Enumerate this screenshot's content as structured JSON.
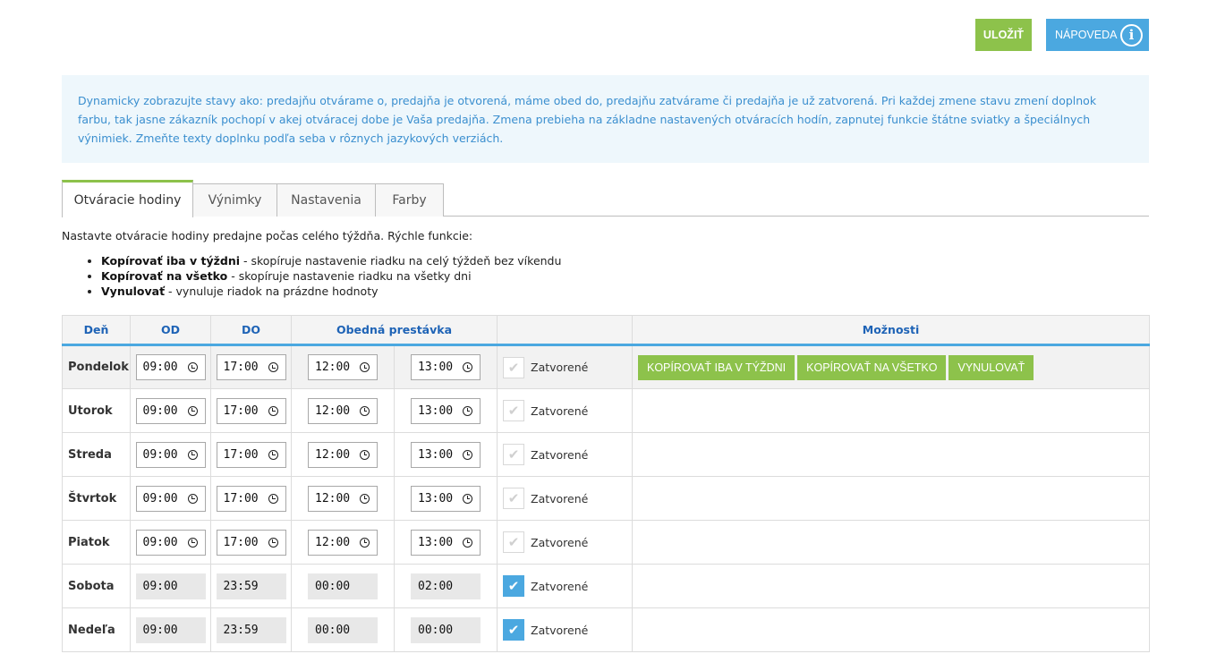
{
  "header": {
    "save_label": "ULOŽIŤ",
    "help_label": "NÁPOVEDA",
    "help_icon": "info-icon"
  },
  "notice": {
    "text": "Dynamicky zobrazujte stavy ako: predajňu otvárame o, predajňa je otvorená, máme obed do, predajňu zatvárame či predajňa je už zatvorená. Pri každej zmene stavu zmení doplnok farbu, tak jasne zákazník pochopí v akej otváracej dobe je Vaša predajňa. Zmena prebieha na základne nastavených otváracích hodín, zapnutej funkcie štátne sviatky a špeciálnych výnimiek. Zmeňte texty doplnku podľa seba v rôznych jazykových verziách."
  },
  "tabs": [
    "Otváracie hodiny",
    "Výnimky",
    "Nastavenia",
    "Farby"
  ],
  "intro": {
    "text": "Nastavte otváracie hodiny predajne počas celého týždňa. Rýchle funkcie:",
    "items": [
      {
        "bold": "Kopírovať iba v týždni",
        "rest": " - skopíruje nastavenie riadku na celý týždeň bez víkendu"
      },
      {
        "bold": "Kopírovať na všetko",
        "rest": " - skopíruje nastavenie riadku na všetky dni"
      },
      {
        "bold": "Vynulovať",
        "rest": " - vynuluje riadok na prázdne hodnoty"
      }
    ]
  },
  "table": {
    "headers": {
      "day": "Deň",
      "od": "OD",
      "do": "DO",
      "break": "Obedná prestávka",
      "blank": "",
      "options": "Možnosti"
    },
    "closed_label": "Zatvorené",
    "options_buttons": [
      "KOPÍROVAŤ IBA V TÝŽDNI",
      "KOPÍROVAŤ NA VŠETKO",
      "VYNULOVAŤ"
    ],
    "rows": [
      {
        "day": "Pondelok",
        "od": "09:00",
        "do": "17:00",
        "break_from": "12:00",
        "break_to": "13:00",
        "closed": false
      },
      {
        "day": "Utorok",
        "od": "09:00",
        "do": "17:00",
        "break_from": "12:00",
        "break_to": "13:00",
        "closed": false
      },
      {
        "day": "Streda",
        "od": "09:00",
        "do": "17:00",
        "break_from": "12:00",
        "break_to": "13:00",
        "closed": false
      },
      {
        "day": "Štvrtok",
        "od": "09:00",
        "do": "17:00",
        "break_from": "12:00",
        "break_to": "13:00",
        "closed": false
      },
      {
        "day": "Piatok",
        "od": "09:00",
        "do": "17:00",
        "break_from": "12:00",
        "break_to": "13:00",
        "closed": false
      },
      {
        "day": "Sobota",
        "od": "09:00",
        "do": "23:59",
        "break_from": "00:00",
        "break_to": "02:00",
        "closed": true
      },
      {
        "day": "Nedeľa",
        "od": "09:00",
        "do": "23:59",
        "break_from": "00:00",
        "break_to": "00:00",
        "closed": true
      }
    ]
  },
  "colors": {
    "accent_green": "#8dc24b",
    "accent_blue": "#4ba8e0",
    "header_text": "#1e63b6"
  }
}
